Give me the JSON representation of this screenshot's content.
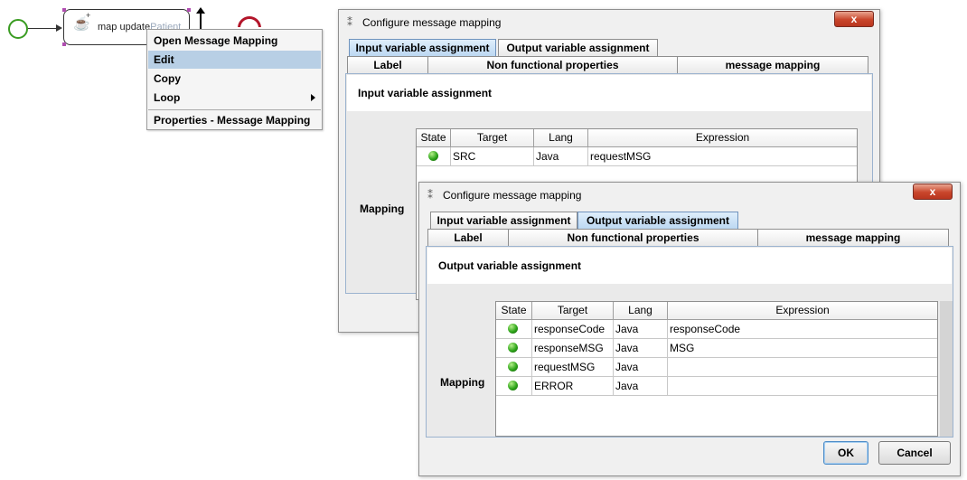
{
  "canvas": {
    "task_label": "map update",
    "task_label_faded": "Patient"
  },
  "context_menu": {
    "items": [
      "Open Message Mapping",
      "Edit",
      "Copy",
      "Loop",
      "Properties - Message Mapping"
    ],
    "highlighted": "Edit"
  },
  "dialog_back": {
    "title": "Configure message mapping",
    "close_label": "x",
    "tabs_top": [
      "Input variable assignment",
      "Output variable assignment"
    ],
    "tabs_bottom": [
      "Label",
      "Non functional properties",
      "message mapping"
    ],
    "active_tab": "Input variable assignment",
    "section_title": "Input variable assignment",
    "mapping_label": "Mapping",
    "columns": [
      "State",
      "Target",
      "Lang",
      "Expression"
    ],
    "rows": [
      {
        "state": "green",
        "target": "SRC",
        "lang": "Java",
        "expression": "requestMSG"
      }
    ]
  },
  "dialog_front": {
    "title": "Configure message mapping",
    "close_label": "x",
    "tabs_top": [
      "Input variable assignment",
      "Output variable assignment"
    ],
    "tabs_bottom": [
      "Label",
      "Non functional properties",
      "message mapping"
    ],
    "active_tab": "Output variable assignment",
    "section_title": "Output variable assignment",
    "mapping_label": "Mapping",
    "columns": [
      "State",
      "Target",
      "Lang",
      "Expression"
    ],
    "rows": [
      {
        "state": "green",
        "target": "responseCode",
        "lang": "Java",
        "expression": "responseCode"
      },
      {
        "state": "green",
        "target": "responseMSG",
        "lang": "Java",
        "expression": "MSG"
      },
      {
        "state": "green",
        "target": "requestMSG",
        "lang": "Java",
        "expression": ""
      },
      {
        "state": "green",
        "target": "ERROR",
        "lang": "Java",
        "expression": ""
      }
    ],
    "ok_label": "OK",
    "cancel_label": "Cancel"
  },
  "colors": {
    "start_event": "#3a9c22",
    "end_event": "#b3152a",
    "menu_highlight": "#b8cfe5",
    "active_tab": "#bcd8f2",
    "status_green": "#2ea51a"
  }
}
